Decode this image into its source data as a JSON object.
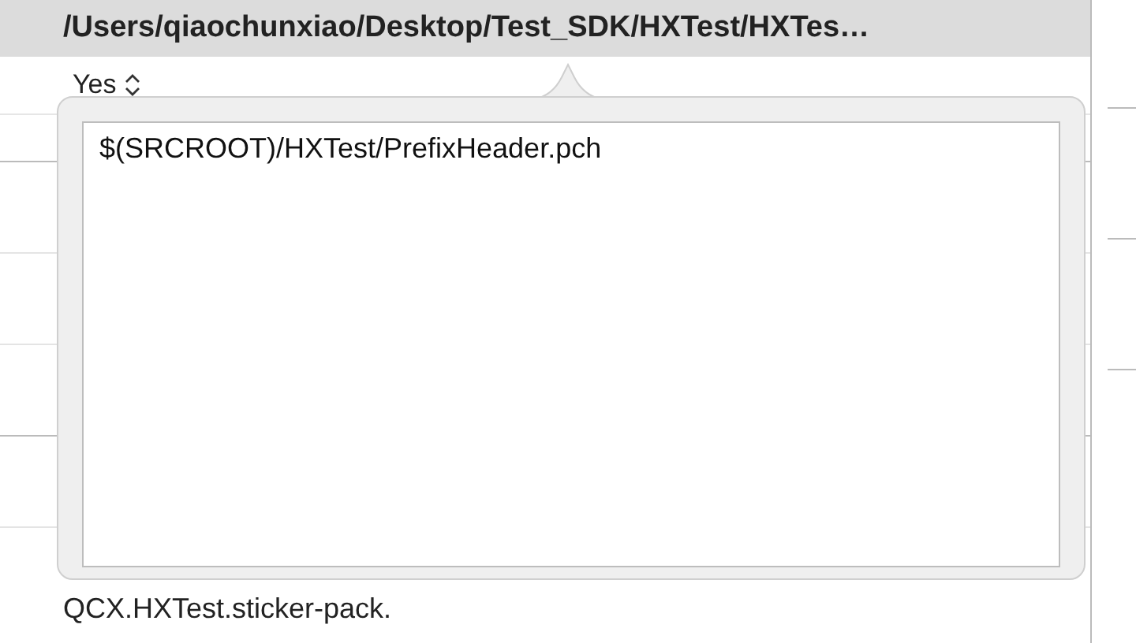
{
  "header": {
    "path": "/Users/qiaochunxiao/Desktop/Test_SDK/HXTest/HXTes…"
  },
  "setting_row": {
    "value": "Yes"
  },
  "popover": {
    "text_area": {
      "value": "$(SRCROOT)/HXTest/PrefixHeader.pch"
    }
  },
  "bottom_row": {
    "value": "QCX.HXTest.sticker-pack."
  }
}
